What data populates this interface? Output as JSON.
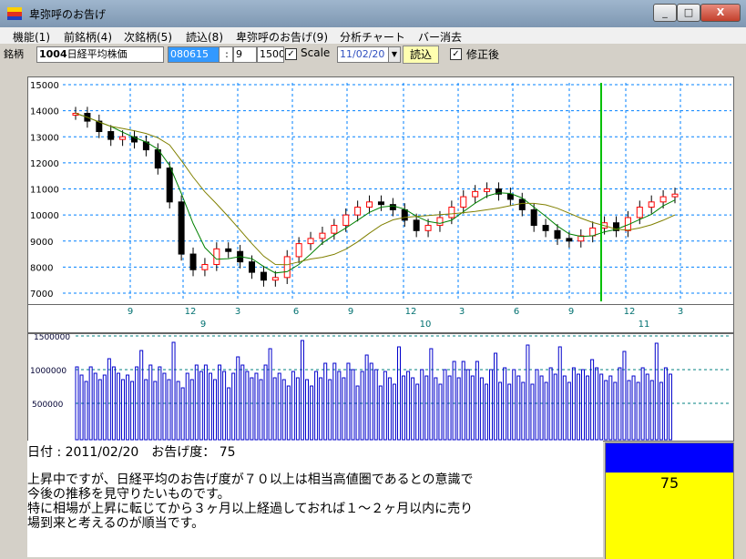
{
  "window": {
    "title": "卑弥呼のお告げ",
    "buttons": {
      "minimize": "_",
      "maximize": "□",
      "close": "X"
    }
  },
  "menu": [
    "機能(1)",
    "前銘柄(4)",
    "次銘柄(5)",
    "読込(8)",
    "卑弥呼のお告げ(9)",
    "分析チャート",
    "バー消去"
  ],
  "toolbar": {
    "stock_label": "銘柄",
    "stock_code": "1004",
    "stock_name": "日経平均株価",
    "date_field": "080615",
    "range_btn": ":",
    "param1": "9",
    "param2": "1500",
    "scale_label": "Scale",
    "scale_checked": true,
    "date_select": "11/02/20",
    "load_button": "読込",
    "adjusted_label": "修正後",
    "adjusted_checked": true
  },
  "price_chart": {
    "y_ticks": [
      "15000",
      "14000",
      "13000",
      "12000",
      "11000",
      "10000",
      "9000",
      "8000",
      "7000"
    ],
    "month_ticks": [
      "9",
      "12",
      "3",
      "6",
      "9",
      "12",
      "3",
      "6",
      "9",
      "12",
      "3"
    ],
    "year_ticks": [
      "9",
      "10",
      "11"
    ],
    "colors": {
      "up": "#ff0000",
      "down": "#000000",
      "ma_short": "#008000",
      "ma_long": "#808000",
      "grid": "#0080ff",
      "marker": "#00c000"
    }
  },
  "volume_chart": {
    "y_ticks": [
      "1500000",
      "1000000",
      "500000"
    ],
    "color": "#0000cc"
  },
  "result": {
    "date_line": "日付 : 2011/02/20　お告げ度： 75",
    "message_lines": [
      "上昇中ですが、日経平均のお告げ度が７０以上は相当高値圏であるとの意識で",
      "今後の推移を見守りたいものです。",
      "特に相場が上昇に転じてから３ヶ月以上経過しておれば１～２ヶ月以内に売り",
      "場到来と考えるのが順当です。"
    ],
    "gauge_value": "75",
    "gauge_level": 0.75
  }
}
